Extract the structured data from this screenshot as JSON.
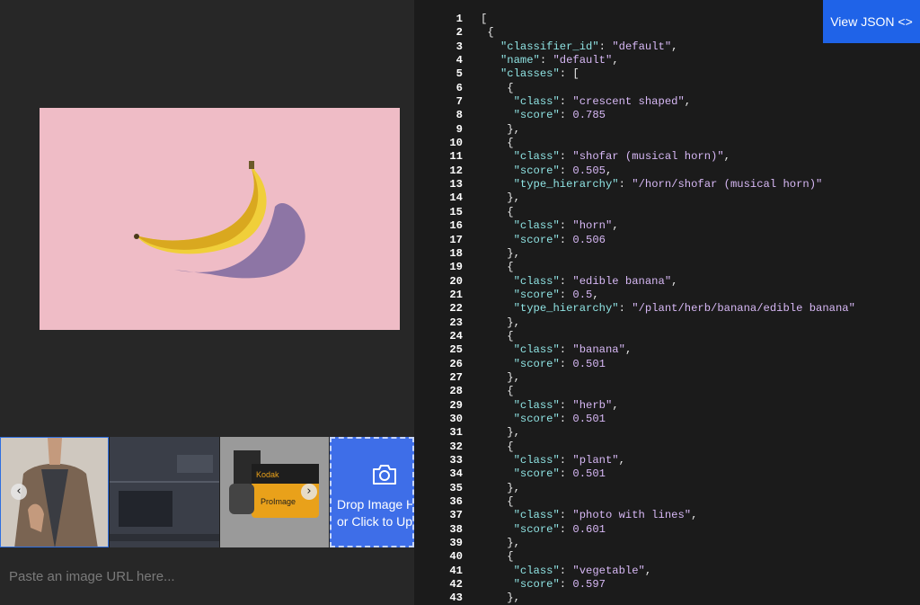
{
  "header": {
    "view_json_label": "View JSON <>"
  },
  "dropzone": {
    "line1": "Drop Image Here",
    "line2": "or Click to Upload"
  },
  "url_input": {
    "placeholder": "Paste an image URL here..."
  },
  "thumbnails": [
    {
      "name": "man-in-jacket"
    },
    {
      "name": "circuit-board"
    },
    {
      "name": "kodak-film-roll"
    }
  ],
  "colors": {
    "accent": "#1f63e8",
    "key": "#8fe3e3",
    "value": "#d7b8f5",
    "preview_bg": "#efbcc6"
  },
  "code_lines": [
    [
      [
        "p",
        "["
      ]
    ],
    [
      [
        "p",
        " {"
      ]
    ],
    [
      [
        "p",
        "   "
      ],
      [
        "k",
        "\"classifier_id\""
      ],
      [
        "p",
        ": "
      ],
      [
        "s",
        "\"default\""
      ],
      [
        "p",
        ","
      ]
    ],
    [
      [
        "p",
        "   "
      ],
      [
        "k",
        "\"name\""
      ],
      [
        "p",
        ": "
      ],
      [
        "s",
        "\"default\""
      ],
      [
        "p",
        ","
      ]
    ],
    [
      [
        "p",
        "   "
      ],
      [
        "k",
        "\"classes\""
      ],
      [
        "p",
        ": ["
      ]
    ],
    [
      [
        "p",
        "    {"
      ]
    ],
    [
      [
        "p",
        "     "
      ],
      [
        "k",
        "\"class\""
      ],
      [
        "p",
        ": "
      ],
      [
        "s",
        "\"crescent shaped\""
      ],
      [
        "p",
        ","
      ]
    ],
    [
      [
        "p",
        "     "
      ],
      [
        "k",
        "\"score\""
      ],
      [
        "p",
        ": "
      ],
      [
        "n",
        "0.785"
      ]
    ],
    [
      [
        "p",
        "    },"
      ]
    ],
    [
      [
        "p",
        "    {"
      ]
    ],
    [
      [
        "p",
        "     "
      ],
      [
        "k",
        "\"class\""
      ],
      [
        "p",
        ": "
      ],
      [
        "s",
        "\"shofar (musical horn)\""
      ],
      [
        "p",
        ","
      ]
    ],
    [
      [
        "p",
        "     "
      ],
      [
        "k",
        "\"score\""
      ],
      [
        "p",
        ": "
      ],
      [
        "n",
        "0.505"
      ],
      [
        "p",
        ","
      ]
    ],
    [
      [
        "p",
        "     "
      ],
      [
        "k",
        "\"type_hierarchy\""
      ],
      [
        "p",
        ": "
      ],
      [
        "s",
        "\"/horn/shofar (musical horn)\""
      ]
    ],
    [
      [
        "p",
        "    },"
      ]
    ],
    [
      [
        "p",
        "    {"
      ]
    ],
    [
      [
        "p",
        "     "
      ],
      [
        "k",
        "\"class\""
      ],
      [
        "p",
        ": "
      ],
      [
        "s",
        "\"horn\""
      ],
      [
        "p",
        ","
      ]
    ],
    [
      [
        "p",
        "     "
      ],
      [
        "k",
        "\"score\""
      ],
      [
        "p",
        ": "
      ],
      [
        "n",
        "0.506"
      ]
    ],
    [
      [
        "p",
        "    },"
      ]
    ],
    [
      [
        "p",
        "    {"
      ]
    ],
    [
      [
        "p",
        "     "
      ],
      [
        "k",
        "\"class\""
      ],
      [
        "p",
        ": "
      ],
      [
        "s",
        "\"edible banana\""
      ],
      [
        "p",
        ","
      ]
    ],
    [
      [
        "p",
        "     "
      ],
      [
        "k",
        "\"score\""
      ],
      [
        "p",
        ": "
      ],
      [
        "n",
        "0.5"
      ],
      [
        "p",
        ","
      ]
    ],
    [
      [
        "p",
        "     "
      ],
      [
        "k",
        "\"type_hierarchy\""
      ],
      [
        "p",
        ": "
      ],
      [
        "s",
        "\"/plant/herb/banana/edible banana\""
      ]
    ],
    [
      [
        "p",
        "    },"
      ]
    ],
    [
      [
        "p",
        "    {"
      ]
    ],
    [
      [
        "p",
        "     "
      ],
      [
        "k",
        "\"class\""
      ],
      [
        "p",
        ": "
      ],
      [
        "s",
        "\"banana\""
      ],
      [
        "p",
        ","
      ]
    ],
    [
      [
        "p",
        "     "
      ],
      [
        "k",
        "\"score\""
      ],
      [
        "p",
        ": "
      ],
      [
        "n",
        "0.501"
      ]
    ],
    [
      [
        "p",
        "    },"
      ]
    ],
    [
      [
        "p",
        "    {"
      ]
    ],
    [
      [
        "p",
        "     "
      ],
      [
        "k",
        "\"class\""
      ],
      [
        "p",
        ": "
      ],
      [
        "s",
        "\"herb\""
      ],
      [
        "p",
        ","
      ]
    ],
    [
      [
        "p",
        "     "
      ],
      [
        "k",
        "\"score\""
      ],
      [
        "p",
        ": "
      ],
      [
        "n",
        "0.501"
      ]
    ],
    [
      [
        "p",
        "    },"
      ]
    ],
    [
      [
        "p",
        "    {"
      ]
    ],
    [
      [
        "p",
        "     "
      ],
      [
        "k",
        "\"class\""
      ],
      [
        "p",
        ": "
      ],
      [
        "s",
        "\"plant\""
      ],
      [
        "p",
        ","
      ]
    ],
    [
      [
        "p",
        "     "
      ],
      [
        "k",
        "\"score\""
      ],
      [
        "p",
        ": "
      ],
      [
        "n",
        "0.501"
      ]
    ],
    [
      [
        "p",
        "    },"
      ]
    ],
    [
      [
        "p",
        "    {"
      ]
    ],
    [
      [
        "p",
        "     "
      ],
      [
        "k",
        "\"class\""
      ],
      [
        "p",
        ": "
      ],
      [
        "s",
        "\"photo with lines\""
      ],
      [
        "p",
        ","
      ]
    ],
    [
      [
        "p",
        "     "
      ],
      [
        "k",
        "\"score\""
      ],
      [
        "p",
        ": "
      ],
      [
        "n",
        "0.601"
      ]
    ],
    [
      [
        "p",
        "    },"
      ]
    ],
    [
      [
        "p",
        "    {"
      ]
    ],
    [
      [
        "p",
        "     "
      ],
      [
        "k",
        "\"class\""
      ],
      [
        "p",
        ": "
      ],
      [
        "s",
        "\"vegetable\""
      ],
      [
        "p",
        ","
      ]
    ],
    [
      [
        "p",
        "     "
      ],
      [
        "k",
        "\"score\""
      ],
      [
        "p",
        ": "
      ],
      [
        "n",
        "0.597"
      ]
    ],
    [
      [
        "p",
        "    },"
      ]
    ]
  ]
}
